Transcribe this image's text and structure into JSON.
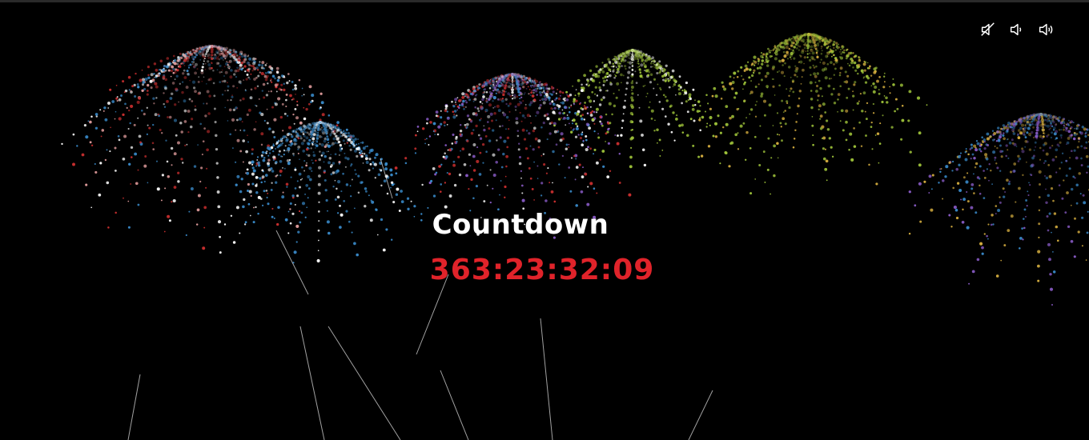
{
  "countdown": {
    "title": "Countdown",
    "time": "363:23:32:09"
  },
  "sound_controls": [
    {
      "icon": "volume-mute-icon"
    },
    {
      "icon": "volume-low-icon"
    },
    {
      "icon": "volume-high-icon"
    }
  ],
  "colors": {
    "background": "#000000",
    "title": "#ffffff",
    "timer": "#e0232a",
    "firework_palette": [
      "#d03030",
      "#3a8ccc",
      "#8a5cc8",
      "#9fc43a",
      "#d8b040",
      "#e6a0a0",
      "#ffffff"
    ]
  }
}
